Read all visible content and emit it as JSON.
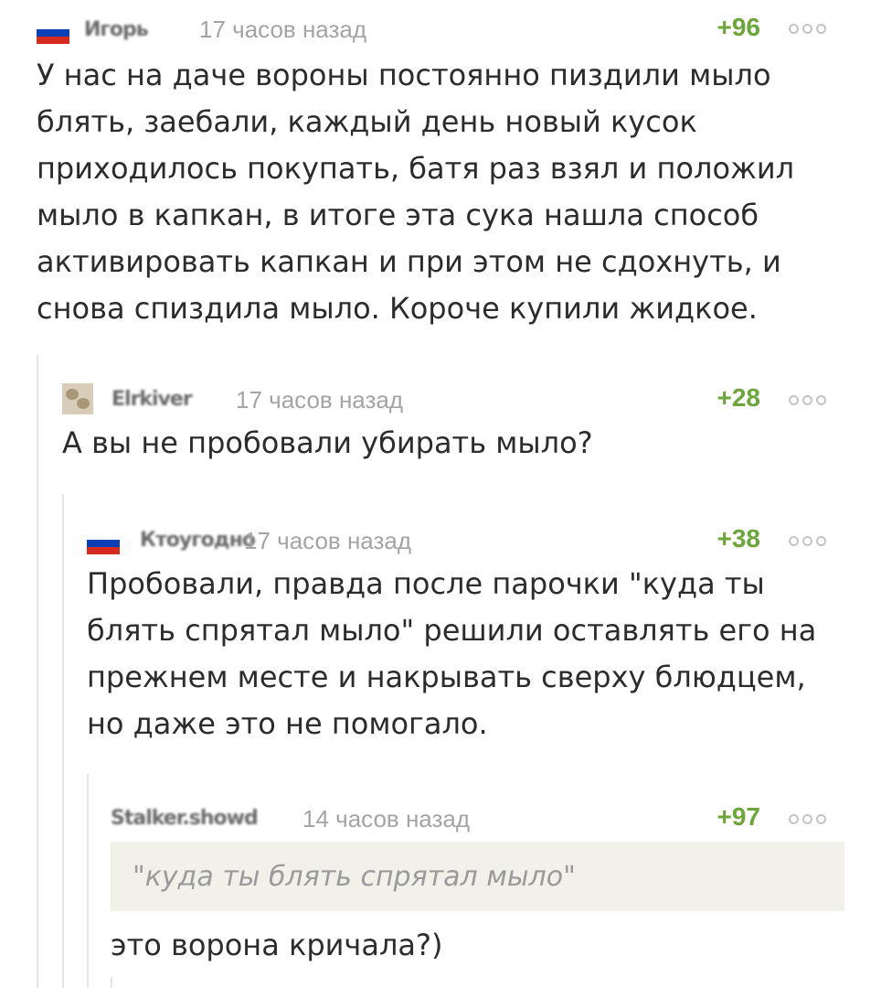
{
  "comments": [
    {
      "nick": "Игорь",
      "time": "17 часов назад",
      "rating": "+96",
      "text": "У нас на даче вороны постоянно пиздили мыло блять, заебали, каждый день новый кусок приходилось покупать, батя раз взял и положил мыло в капкан, в итоге эта сука нашла способ активировать капкан и при этом не сдохнуть, и снова спиздила мыло. Короче купили жидкое."
    },
    {
      "nick": "Elrkiver",
      "time": "17 часов назад",
      "rating": "+28",
      "text": "А вы не пробовали убирать мыло?"
    },
    {
      "nick": "Ктоугодно",
      "time": "17 часов назад",
      "rating": "+38",
      "text": "Пробовали, правда после парочки \"куда ты блять спрятал мыло\" решили оставлять его на прежнем месте и накрывать сверху блюдцем, но даже это не помогало."
    },
    {
      "nick": "Stalker.showd",
      "time": "14 часов назад",
      "rating": "+97",
      "quote": "\"куда ты блять спрятал мыло\"",
      "text": "это ворона кричала?)"
    }
  ],
  "colors": {
    "rating": "#6ca63a",
    "time": "#a4a4a4",
    "quote_bg": "#f1f1ea",
    "flag_white": "#ffffff",
    "flag_blue": "#0b3fb5",
    "flag_red": "#d52b1e"
  },
  "icons": {
    "flag": "russia-flag-icon",
    "more": "more-options-icon",
    "avatar": "user-avatar-icon"
  }
}
